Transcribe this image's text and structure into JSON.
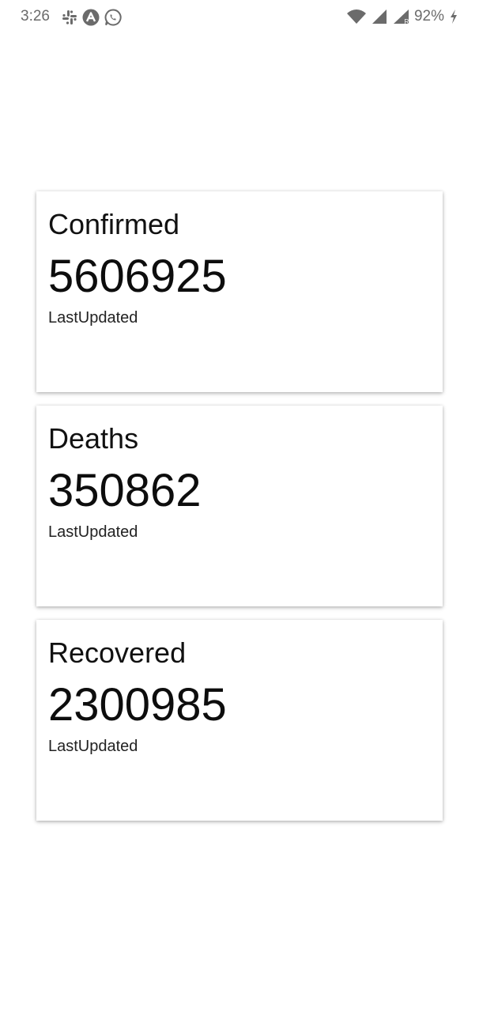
{
  "status_bar": {
    "time": "3:26",
    "battery_percent": "92%",
    "left_icons": [
      "slack-icon",
      "arch-icon",
      "whatsapp-icon"
    ],
    "right_icons": [
      "wifi-icon",
      "signal-icon",
      "signal-roaming-icon",
      "battery-charging-icon"
    ],
    "icon_color": "#6b6b6b"
  },
  "cards": [
    {
      "title": "Confirmed",
      "count": "5606925",
      "updated_label": "LastUpdated"
    },
    {
      "title": "Deaths",
      "count": "350862",
      "updated_label": "LastUpdated"
    },
    {
      "title": "Recovered",
      "count": "2300985",
      "updated_label": "LastUpdated"
    }
  ]
}
